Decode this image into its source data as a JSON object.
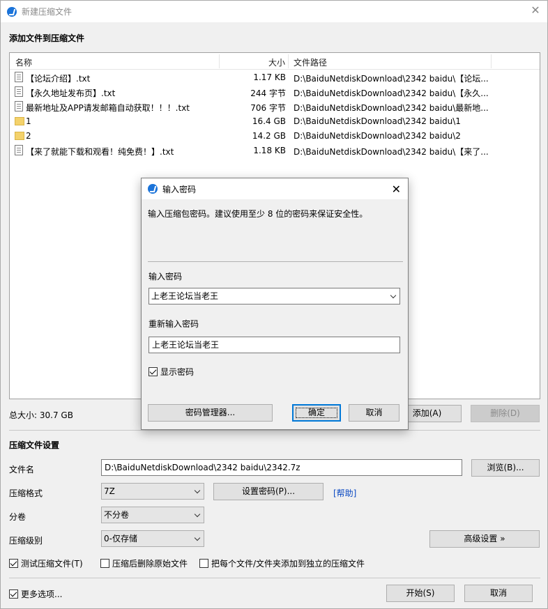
{
  "window": {
    "title": "新建压缩文件"
  },
  "add_section": {
    "title": "添加文件到压缩文件",
    "columns": {
      "name": "名称",
      "size": "大小",
      "path": "文件路径"
    },
    "files": [
      {
        "icon": "txt",
        "name": "【论坛介绍】.txt",
        "size": "1.17 KB",
        "path": "D:\\BaiduNetdiskDownload\\2342 baidu\\【论坛..."
      },
      {
        "icon": "txt",
        "name": "【永久地址发布页】.txt",
        "size": "244 字节",
        "path": "D:\\BaiduNetdiskDownload\\2342 baidu\\【永久..."
      },
      {
        "icon": "txt",
        "name": "最新地址及APP请发邮箱自动获取！！！.txt",
        "size": "706 字节",
        "path": "D:\\BaiduNetdiskDownload\\2342 baidu\\最新地..."
      },
      {
        "icon": "folder",
        "name": "1",
        "size": "16.4 GB",
        "path": "D:\\BaiduNetdiskDownload\\2342 baidu\\1"
      },
      {
        "icon": "folder",
        "name": "2",
        "size": "14.2 GB",
        "path": "D:\\BaiduNetdiskDownload\\2342 baidu\\2"
      },
      {
        "icon": "txt",
        "name": "【来了就能下载和观看！纯免费！】.txt",
        "size": "1.18 KB",
        "path": "D:\\BaiduNetdiskDownload\\2342 baidu\\【来了..."
      }
    ],
    "total_size": "总大小: 30.7 GB",
    "add_button": "添加(A)",
    "delete_button": "删除(D)"
  },
  "settings": {
    "title": "压缩文件设置",
    "filename_label": "文件名",
    "filename_value": "D:\\BaiduNetdiskDownload\\2342 baidu\\2342.7z",
    "browse_button": "浏览(B)...",
    "format_label": "压缩格式",
    "format_value": "7Z",
    "set_password_button": "设置密码(P)...",
    "help_link": "[帮助]",
    "volume_label": "分卷",
    "volume_value": "不分卷",
    "level_label": "压缩级别",
    "level_value": "0-仅存储",
    "advanced_button": "高级设置 »",
    "test_check": "测试压缩文件(T)",
    "delete_after_check": "压缩后删除原始文件",
    "separate_check": "把每个文件/文件夹添加到独立的压缩文件",
    "more_options_check": "更多选项...",
    "start_button": "开始(S)",
    "cancel_button": "取消"
  },
  "password_dialog": {
    "title": "输入密码",
    "hint": "输入压缩包密码。建议使用至少 8 位的密码来保证安全性。",
    "password_label": "输入密码",
    "password_value": "上老王论坛当老王",
    "confirm_label": "重新输入密码",
    "confirm_value": "上老王论坛当老王",
    "show_password": "显示密码",
    "manager_button": "密码管理器...",
    "ok_button": "确定",
    "cancel_button": "取消"
  }
}
